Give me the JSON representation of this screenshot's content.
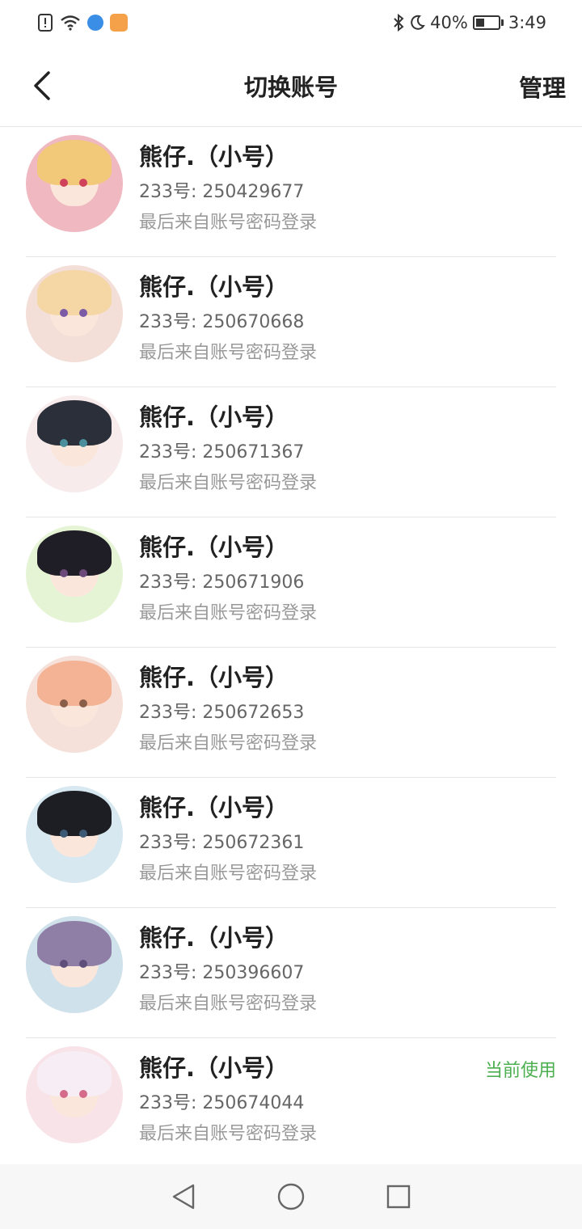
{
  "status_bar": {
    "time": "3:49",
    "battery_text": "40%",
    "battery_level": 0.4,
    "icons": [
      "alert-icon",
      "wifi-icon",
      "app-notification-icon",
      "app-notification-icon-2",
      "bluetooth-icon",
      "moon-icon",
      "battery-icon"
    ]
  },
  "header": {
    "title": "切换账号",
    "manage_label": "管理"
  },
  "accounts": [
    {
      "name": "熊仔.（小号）",
      "id_text": "233号: 250429677",
      "login_text": "最后来自账号密码登录",
      "current": false,
      "avatar_colors": {
        "bg": "#f0b8c0",
        "hair": "#f2c979",
        "eye": "#d0425c"
      }
    },
    {
      "name": "熊仔.（小号）",
      "id_text": "233号: 250670668",
      "login_text": "最后来自账号密码登录",
      "current": false,
      "avatar_colors": {
        "bg": "#f3ded8",
        "hair": "#f5d7a5",
        "eye": "#7b5aa6"
      }
    },
    {
      "name": "熊仔.（小号）",
      "id_text": "233号: 250671367",
      "login_text": "最后来自账号密码登录",
      "current": false,
      "avatar_colors": {
        "bg": "#f7eceb",
        "hair": "#2b2f3a",
        "eye": "#4a8f9b"
      }
    },
    {
      "name": "熊仔.（小号）",
      "id_text": "233号: 250671906",
      "login_text": "最后来自账号密码登录",
      "current": false,
      "avatar_colors": {
        "bg": "#e6f4d6",
        "hair": "#1f1d26",
        "eye": "#6b4a7a"
      }
    },
    {
      "name": "熊仔.（小号）",
      "id_text": "233号: 250672653",
      "login_text": "最后来自账号密码登录",
      "current": false,
      "avatar_colors": {
        "bg": "#f6e1da",
        "hair": "#f3b394",
        "eye": "#8a5f4a"
      }
    },
    {
      "name": "熊仔.（小号）",
      "id_text": "233号: 250672361",
      "login_text": "最后来自账号密码登录",
      "current": false,
      "avatar_colors": {
        "bg": "#d8e8f0",
        "hair": "#1d1e23",
        "eye": "#3d5973"
      }
    },
    {
      "name": "熊仔.（小号）",
      "id_text": "233号: 250396607",
      "login_text": "最后来自账号密码登录",
      "current": false,
      "avatar_colors": {
        "bg": "#cfe1ea",
        "hair": "#8f7fa6",
        "eye": "#5d4f7a"
      }
    },
    {
      "name": "熊仔.（小号）",
      "id_text": "233号: 250674044",
      "login_text": "最后来自账号密码登录",
      "current": true,
      "current_label": "当前使用",
      "avatar_colors": {
        "bg": "#f7e3e8",
        "hair": "#f6eef4",
        "eye": "#d56b8b"
      }
    }
  ],
  "nav_bar": {
    "icons": [
      "back-triangle-icon",
      "home-circle-icon",
      "recents-square-icon"
    ]
  },
  "colors": {
    "accent_green": "#4caf50",
    "divider": "#e6e6e6"
  }
}
